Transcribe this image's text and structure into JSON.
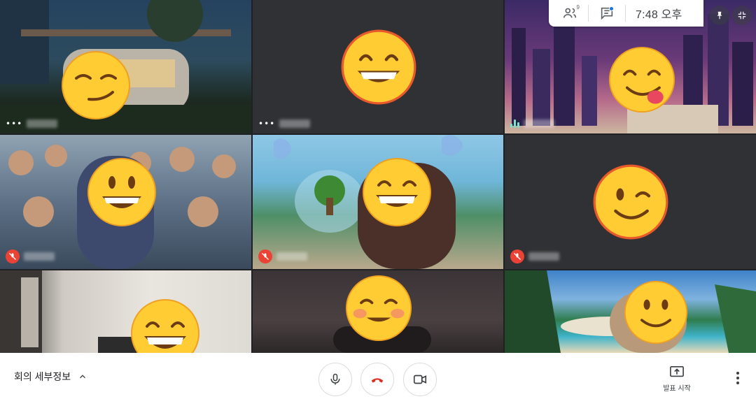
{
  "top_panel": {
    "time": "7:48 오후",
    "people_count": "9",
    "people_icon": "people-icon",
    "chat_icon": "chat-icon",
    "pin_icon": "pin-icon",
    "fullscreen_icon": "fullscreen-exit-icon"
  },
  "tiles": [
    {
      "id": 1,
      "background": "backyard trailer at night",
      "emoji": "smirking-face",
      "audio": "speaking-dots",
      "muted": false
    },
    {
      "id": 2,
      "background": "dark gray",
      "emoji": "grinning-face",
      "audio": "speaking-dots",
      "muted": false
    },
    {
      "id": 3,
      "background": "city skyline purple",
      "emoji": "face-savoring-food",
      "audio": "active-equalizer",
      "muted": false
    },
    {
      "id": 4,
      "background": "anime crowd",
      "emoji": "grinning-face-big-eyes",
      "audio": "muted",
      "muted": true
    },
    {
      "id": 5,
      "background": "bikini bottom",
      "emoji": "beaming-face",
      "audio": "muted",
      "muted": true
    },
    {
      "id": 6,
      "background": "dark gray",
      "emoji": "winking-face",
      "audio": "muted",
      "muted": true
    },
    {
      "id": 7,
      "background": "bright room",
      "emoji": "laughing-face",
      "audio": "none",
      "muted": false
    },
    {
      "id": 8,
      "background": "dim room",
      "emoji": "smiling-blushing-face",
      "audio": "none",
      "muted": false
    },
    {
      "id": 9,
      "background": "tropical beach",
      "emoji": "slightly-smiling-face",
      "audio": "none",
      "muted": false
    }
  ],
  "bottom_bar": {
    "meeting_details_label": "회의 세부정보",
    "present_label": "발표 시작",
    "mic_icon": "microphone-icon",
    "end_call_icon": "end-call-icon",
    "camera_icon": "camera-icon",
    "more_icon": "more-vert-icon",
    "colors": {
      "end_call": "#d93025",
      "mute_badge": "#ea4335",
      "accent": "#1a73e8"
    }
  }
}
